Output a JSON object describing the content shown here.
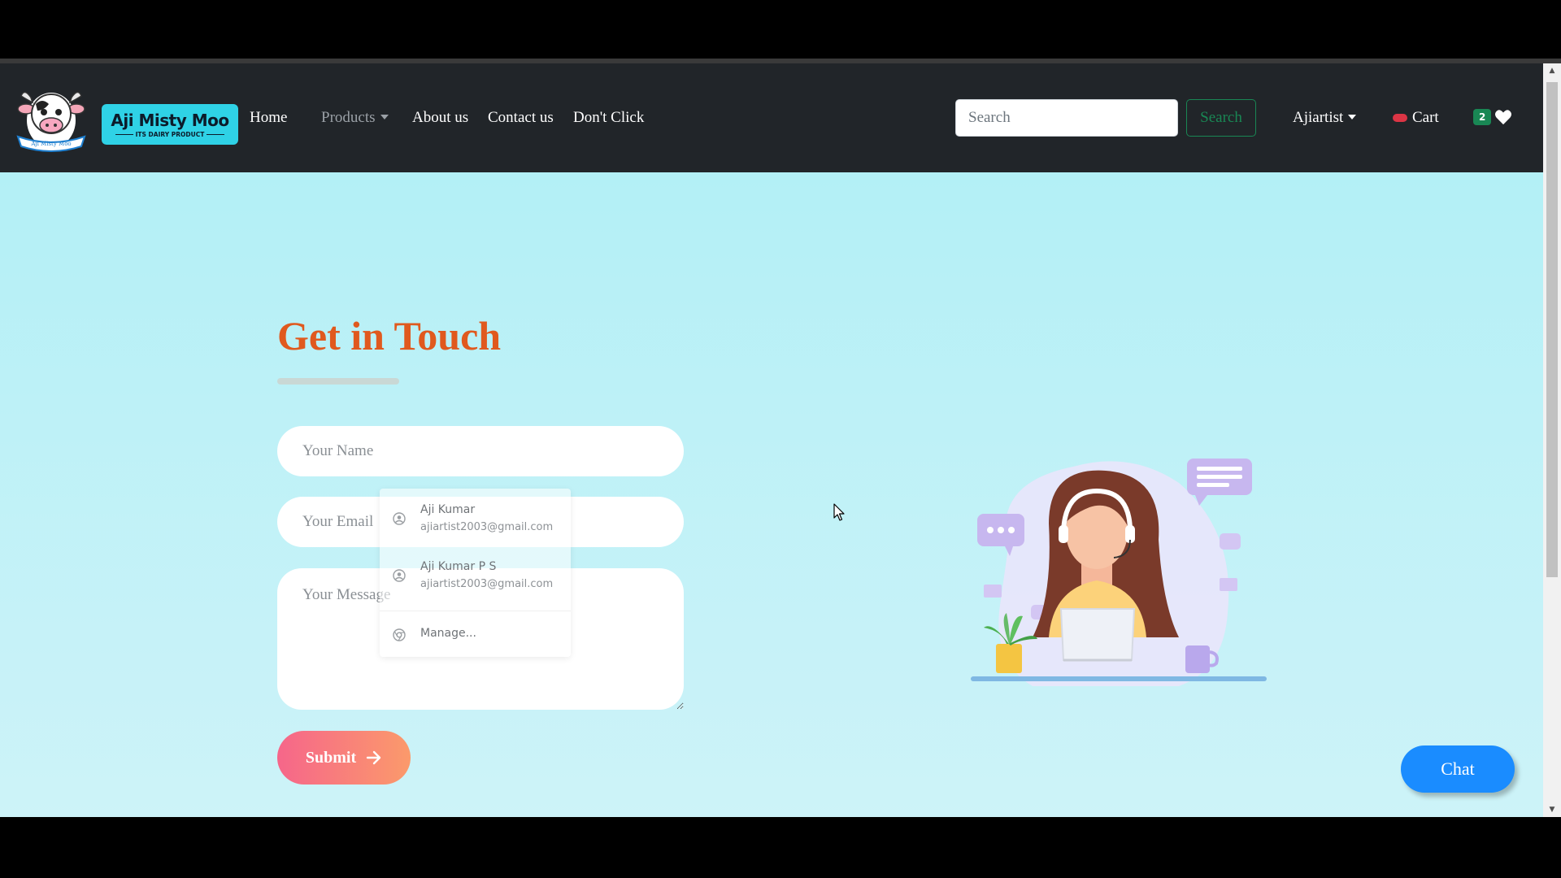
{
  "navbar": {
    "brand_name": "Aji Misty Moo",
    "brand_sub": "ITS DAIRY PRODUCT",
    "logo_banner": "Aji Misty Moo",
    "links": {
      "home": "Home",
      "products": "Products",
      "about": "About us",
      "contact": "Contact us",
      "dont_click": "Don't Click"
    },
    "search": {
      "placeholder": "Search",
      "button": "Search"
    },
    "user": "Ajiartist",
    "cart": "Cart",
    "wishlist_count": "2"
  },
  "form": {
    "title": "Get in Touch",
    "name_placeholder": "Your Name",
    "email_placeholder": "Your Email",
    "message_placeholder": "Your Message",
    "submit": "Submit"
  },
  "autofill": {
    "entries": [
      {
        "name": "Aji Kumar",
        "email": "ajiartist2003@gmail.com"
      },
      {
        "name": "Aji Kumar P S",
        "email": "ajiartist2003@gmail.com"
      }
    ],
    "manage": "Manage..."
  },
  "chat": {
    "label": "Chat"
  },
  "colors": {
    "navbar_bg": "#212529",
    "title": "#e0591e",
    "search_btn": "#198754",
    "chat_btn": "#1a8cff",
    "submit_gradient_start": "#f6668a",
    "submit_gradient_end": "#fb9a6b",
    "page_bg": "#aeeff5"
  },
  "icons": {
    "cart": "cart-pill-icon",
    "wishlist": "heart-icon",
    "submit_arrow": "arrow-right-icon",
    "autofill_profile": "person-circle-icon",
    "autofill_manage": "chrome-icon"
  }
}
